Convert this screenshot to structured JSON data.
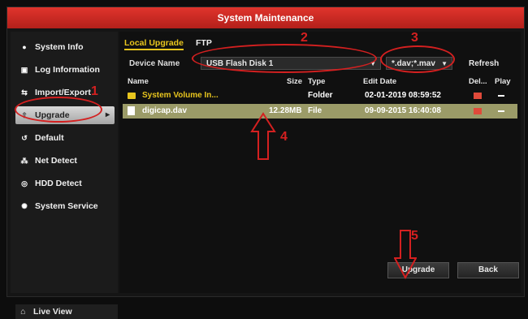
{
  "window": {
    "title": "System Maintenance"
  },
  "sidebar": {
    "items": [
      {
        "label": "System Info",
        "icon": "info-icon"
      },
      {
        "label": "Log Information",
        "icon": "log-icon"
      },
      {
        "label": "Import/Export",
        "icon": "import-export-icon"
      },
      {
        "label": "Upgrade",
        "icon": "upgrade-icon",
        "active": true
      },
      {
        "label": "Default",
        "icon": "default-icon"
      },
      {
        "label": "Net Detect",
        "icon": "net-icon"
      },
      {
        "label": "HDD Detect",
        "icon": "hdd-icon"
      },
      {
        "label": "System Service",
        "icon": "service-icon"
      }
    ],
    "live_view_label": "Live View"
  },
  "tabs": {
    "local_upgrade": "Local Upgrade",
    "ftp": "FTP"
  },
  "device": {
    "label": "Device Name",
    "value": "USB Flash Disk 1",
    "filter": "*.dav;*.mav",
    "refresh": "Refresh"
  },
  "table": {
    "headers": {
      "name": "Name",
      "size": "Size",
      "type": "Type",
      "edit_date": "Edit Date",
      "delete": "Del...",
      "play": "Play"
    },
    "rows": [
      {
        "name": "System Volume In...",
        "size": "",
        "type": "Folder",
        "edit_date": "02-01-2019 08:59:52"
      },
      {
        "name": "digicap.dav",
        "size": "12.28MB",
        "type": "File",
        "edit_date": "09-09-2015 16:40:08"
      }
    ]
  },
  "buttons": {
    "upgrade": "Upgrade",
    "back": "Back"
  },
  "annotations": {
    "n1": "1",
    "n2": "2",
    "n3": "3",
    "n4": "4",
    "n5": "5"
  },
  "colors": {
    "title_red": "#c42a22",
    "annotation_red": "#d42020",
    "accent_yellow": "#e8c51e",
    "selected_row": "#9b9b68"
  }
}
